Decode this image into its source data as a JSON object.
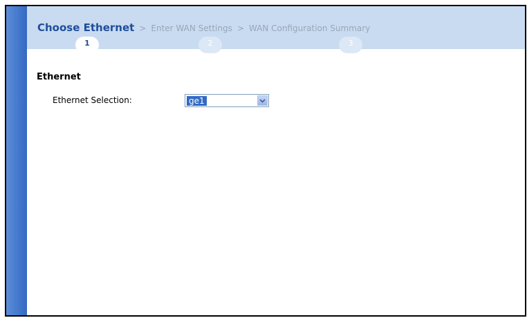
{
  "wizard": {
    "steps": [
      {
        "label": "Choose Ethernet",
        "number": "1"
      },
      {
        "label": "Enter WAN Settings",
        "number": "2"
      },
      {
        "label": "WAN Configuration Summary",
        "number": "3"
      }
    ],
    "separator": ">"
  },
  "section": {
    "title": "Ethernet",
    "field_label": "Ethernet Selection:",
    "field_value": "ge1"
  },
  "colors": {
    "active_step": "#1f4e9a",
    "inactive_step": "#98a6b8",
    "wizard_bar": "#c9dbf1",
    "side_strip": "#4a7fd0"
  },
  "icons": {
    "dropdown": "chevron-down-icon"
  }
}
